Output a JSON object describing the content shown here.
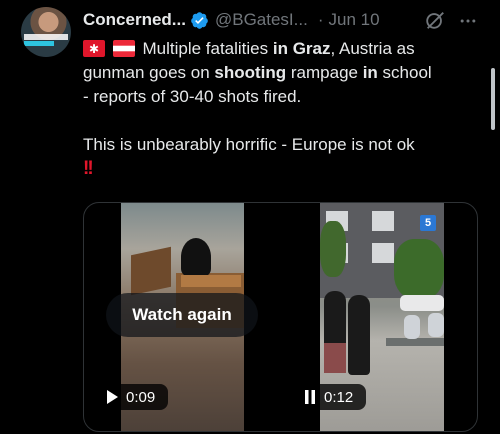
{
  "tweet": {
    "display_name": "Concerned...",
    "handle": "@BGatesI...",
    "date": "Jun 10",
    "text_lines": [
      [
        {
          "t": "Multiple fatalities ",
          "b": false
        },
        {
          "t": "in Graz",
          "b": true
        },
        {
          "t": ", Austria as",
          "b": false
        }
      ],
      [
        {
          "t": "gunman goes on ",
          "b": false
        },
        {
          "t": "shooting",
          "b": true
        },
        {
          "t": " rampage ",
          "b": false
        },
        {
          "t": "in",
          "b": true
        },
        {
          "t": " school",
          "b": false
        }
      ],
      [
        {
          "t": "- reports of 30-40 shots fired.",
          "b": false
        }
      ]
    ],
    "para2": "This is unbearably horrific - Europe is not ok",
    "emphasis": "!!"
  },
  "media": {
    "watch_again_label": "Watch again",
    "video1_time": "0:09",
    "video2_time": "0:12",
    "video2_badge": "5"
  },
  "icons": [
    "verified-badge-icon",
    "grok-icon",
    "more-icon",
    "siren-emoji-icon",
    "austria-flag-icon",
    "play-icon",
    "pause-icon"
  ],
  "colors": {
    "background": "#000000",
    "text": "#e7e9ea",
    "secondary": "#71767b",
    "verified": "#1d9bf0",
    "emphasis": "#e0162b"
  }
}
